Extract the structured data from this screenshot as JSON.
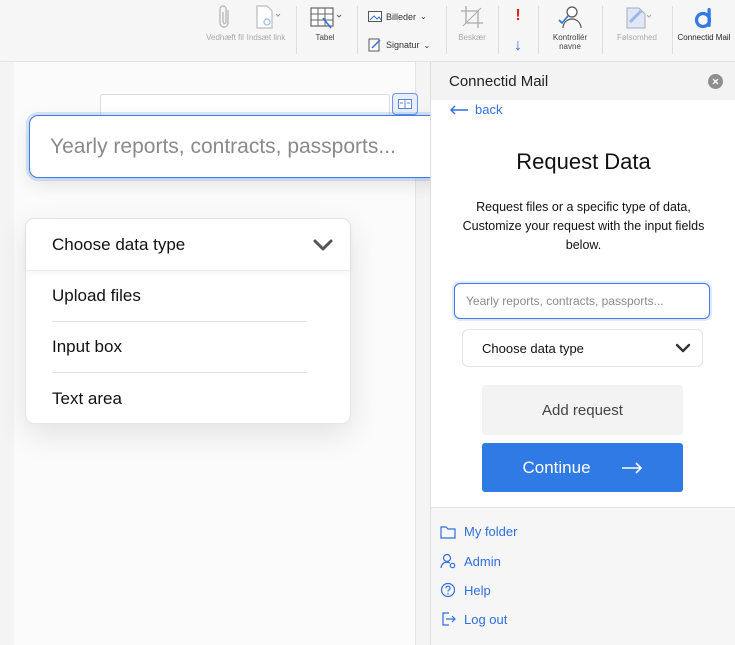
{
  "ribbon": {
    "attach_label": "Vedhæft fil",
    "link_label": "Indsæt link",
    "table_label": "Tabel",
    "images_label": "Billeder",
    "signature_label": "Signatur",
    "crop_label": "Beskær",
    "check_names_label": "Kontrollér navne",
    "sensitivity_label": "Følsomhed",
    "connectid_label": "Connectid Mail"
  },
  "overlay": {
    "search_placeholder": "Yearly reports, contracts, passports...",
    "dropdown_label": "Choose data type",
    "options": [
      "Upload files",
      "Input box",
      "Text area"
    ]
  },
  "panel": {
    "title": "Connectid Mail",
    "back_label": "back",
    "heading": "Request Data",
    "description": "Request files or a specific type of data, Customize your request with the input fields below.",
    "input_placeholder": "Yearly reports, contracts, passports...",
    "select_label": "Choose data type",
    "add_label": "Add request",
    "continue_label": "Continue",
    "nav": [
      {
        "label": "My folder",
        "icon": "folder-icon"
      },
      {
        "label": "Admin",
        "icon": "admin-user-icon"
      },
      {
        "label": "Help",
        "icon": "help-icon"
      },
      {
        "label": "Log out",
        "icon": "logout-icon"
      }
    ]
  },
  "colors": {
    "accent": "#2f7ae5",
    "link": "#2f6fde",
    "focus_border": "#3d7be8"
  }
}
